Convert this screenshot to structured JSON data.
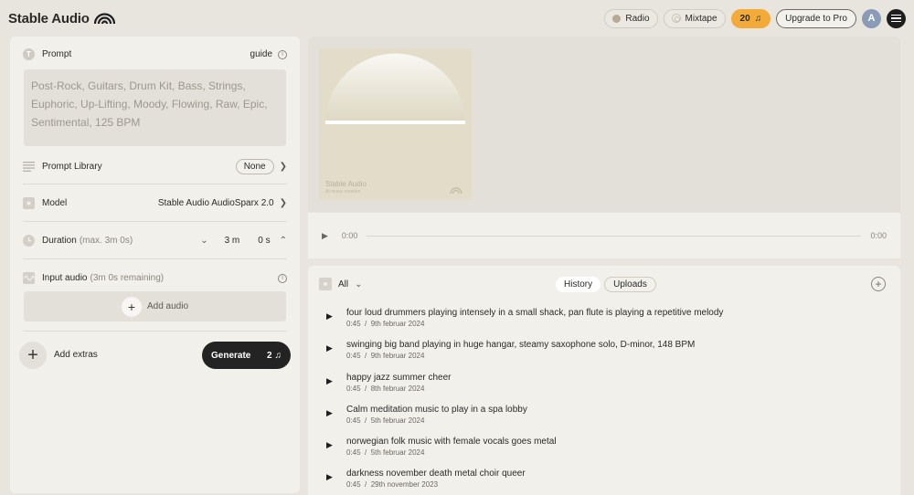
{
  "header": {
    "brand": "Stable Audio",
    "radio_label": "Radio",
    "mixtape_label": "Mixtape",
    "credits": "20",
    "upgrade_label": "Upgrade to Pro",
    "avatar_initial": "A"
  },
  "prompt": {
    "label": "Prompt",
    "guide_label": "guide",
    "text": "Post-Rock, Guitars, Drum Kit, Bass, Strings, Euphoric, Up-Lifting, Moody, Flowing, Raw, Epic, Sentimental, 125 BPM"
  },
  "prompt_library": {
    "label": "Prompt Library",
    "value": "None"
  },
  "model": {
    "label": "Model",
    "value": "Stable Audio AudioSparx 2.0"
  },
  "duration": {
    "label": "Duration",
    "hint": "(max. 3m 0s)",
    "minutes": "3 m",
    "seconds": "0 s"
  },
  "input_audio": {
    "label": "Input audio",
    "hint": "(3m 0s remaining)",
    "add_label": "Add audio"
  },
  "extras": {
    "label": "Add extras"
  },
  "generate": {
    "label": "Generate",
    "cost": "2"
  },
  "cover": {
    "title": "Stable Audio",
    "subtitle": "AI music creation"
  },
  "player": {
    "current_time": "0:00",
    "total_time": "0:00"
  },
  "library": {
    "filter_label": "All",
    "tabs": [
      {
        "label": "History",
        "active": true
      },
      {
        "label": "Uploads",
        "active": false
      }
    ],
    "items": [
      {
        "title": "four loud drummers playing intensely in a small shack, pan flute is playing a repetitive melody",
        "duration": "0:45",
        "date": "9th februar 2024"
      },
      {
        "title": "swinging big band playing in huge hangar, steamy saxophone solo, D-minor, 148 BPM",
        "duration": "0:45",
        "date": "9th februar 2024"
      },
      {
        "title": "happy jazz summer cheer",
        "duration": "0:45",
        "date": "8th februar 2024"
      },
      {
        "title": "Calm meditation music to play in a spa lobby",
        "duration": "0:45",
        "date": "5th februar 2024"
      },
      {
        "title": "norwegian folk music with female vocals goes metal",
        "duration": "0:45",
        "date": "5th februar 2024"
      },
      {
        "title": "darkness november death metal choir queer",
        "duration": "0:45",
        "date": "29th november 2023"
      }
    ]
  },
  "colors": {
    "accent": "#f2ab39",
    "primary_button": "#232323",
    "background": "#e8e5de",
    "panel": "#f2f0eb"
  }
}
